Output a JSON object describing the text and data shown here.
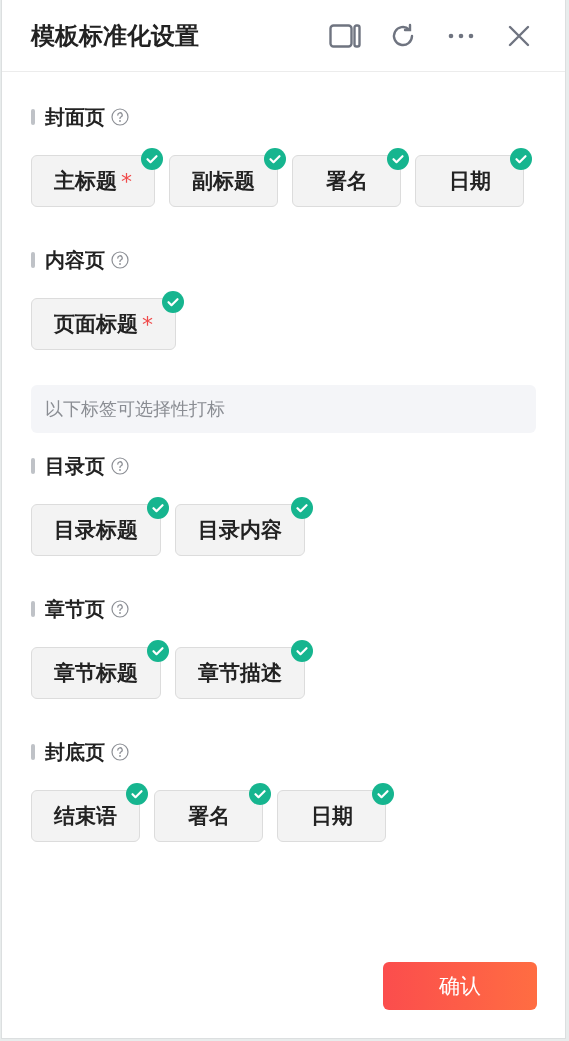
{
  "window": {
    "title": "模板标准化设置"
  },
  "toolbar": [
    {
      "kind": "panel"
    },
    {
      "kind": "refresh"
    },
    {
      "kind": "more"
    },
    {
      "kind": "close"
    }
  ],
  "groups": [
    {
      "kind": "section",
      "title": "封面页",
      "tags": [
        {
          "label": "主标题",
          "mark": "*",
          "checked": true
        },
        {
          "label": "副标题",
          "checked": true
        },
        {
          "label": "署名",
          "checked": true
        },
        {
          "label": "日期",
          "checked": true
        }
      ]
    },
    {
      "kind": "section",
      "title": "内容页",
      "tags": [
        {
          "label": "页面标题",
          "mark": "*",
          "checked": true
        }
      ]
    },
    {
      "kind": "note",
      "text": "以下标签可选择性打标"
    },
    {
      "kind": "section",
      "title": "目录页",
      "tags": [
        {
          "label": "目录标题",
          "checked": true
        },
        {
          "label": "目录内容",
          "checked": true
        }
      ]
    },
    {
      "kind": "section",
      "title": "章节页",
      "tags": [
        {
          "label": "章节标题",
          "checked": true
        },
        {
          "label": "章节描述",
          "checked": true
        }
      ]
    },
    {
      "kind": "section",
      "title": "封底页",
      "tags": [
        {
          "label": "结束语",
          "checked": true
        },
        {
          "label": "署名",
          "checked": true
        },
        {
          "label": "日期",
          "checked": true
        }
      ]
    }
  ],
  "confirm": {
    "label": "确认"
  }
}
